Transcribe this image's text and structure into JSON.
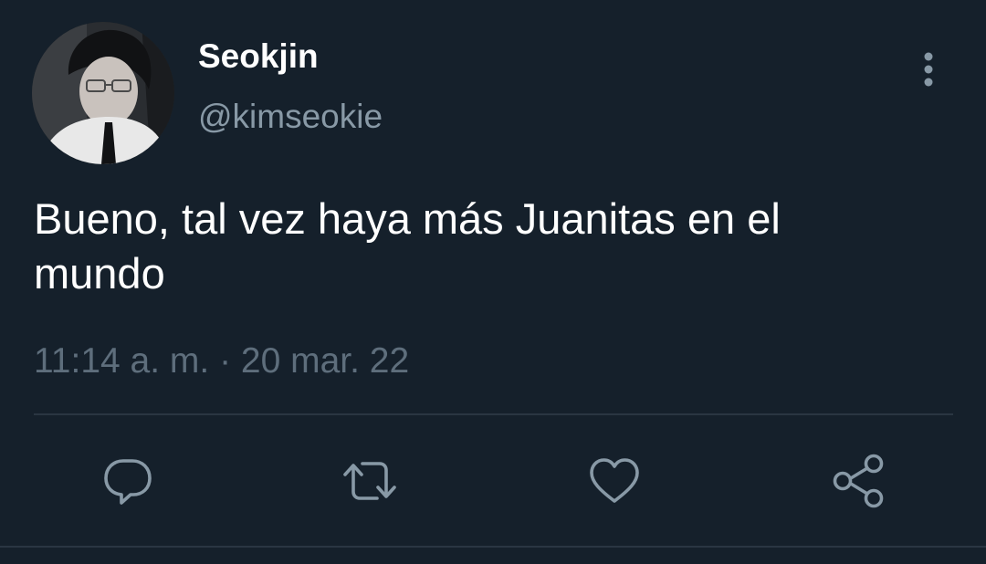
{
  "tweet": {
    "display_name": "Seokjin",
    "handle": "@kimseokie",
    "text": "Bueno, tal vez haya más Juanitas en el mundo",
    "time": "11:14 a. m.",
    "separator": " · ",
    "date": "20 mar. 22"
  },
  "icons": {
    "more": "more-vertical-icon",
    "reply": "reply-icon",
    "retweet": "retweet-icon",
    "like": "heart-icon",
    "share": "share-icon"
  },
  "colors": {
    "background": "#15202b",
    "primary_text": "#ffffff",
    "secondary_text": "#8899a6",
    "muted_text": "#5e6e7c",
    "icon": "#8899a6",
    "divider": "#2a3642"
  }
}
